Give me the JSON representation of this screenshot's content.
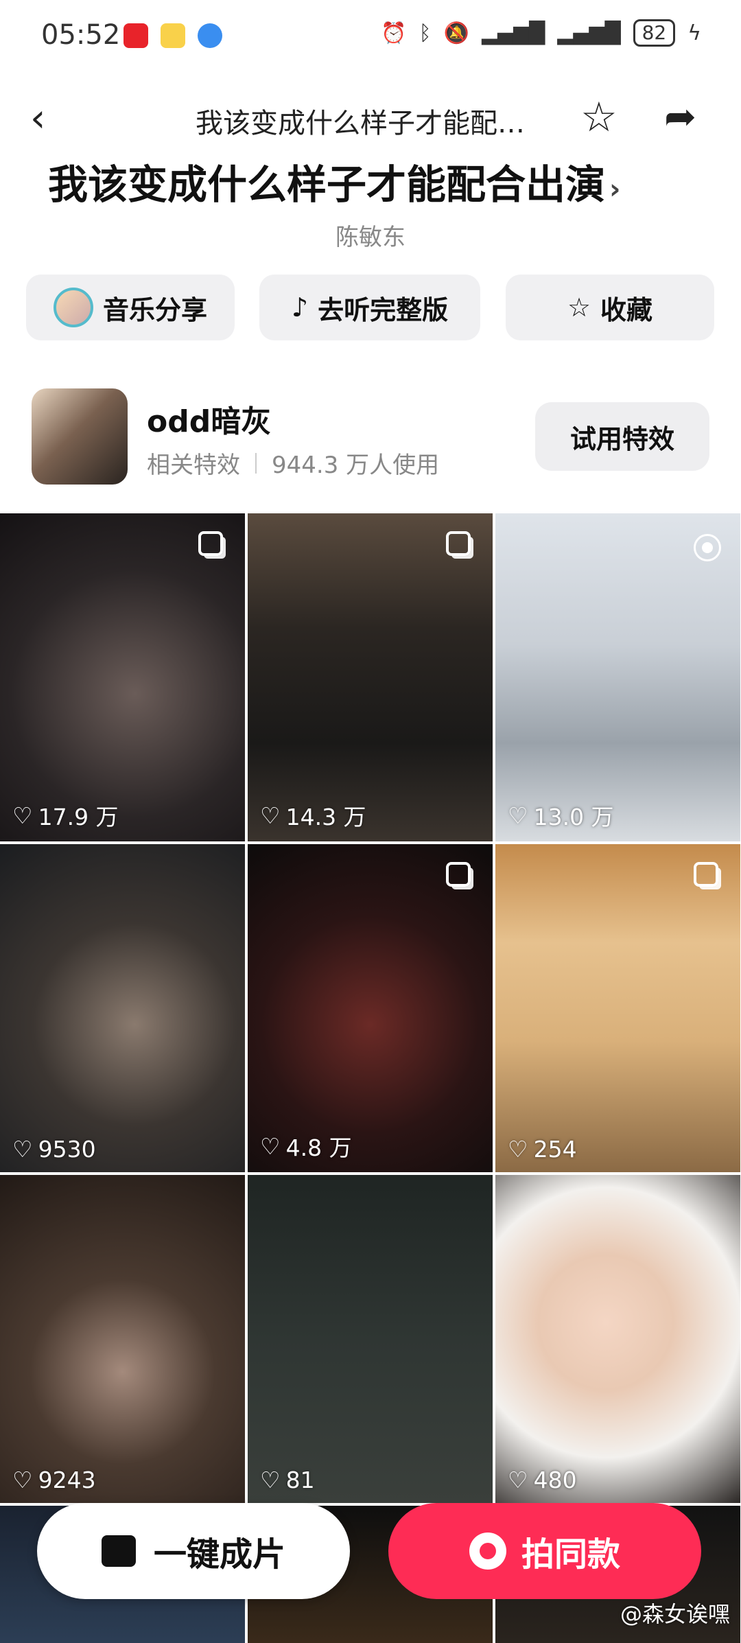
{
  "status_bar": {
    "time": "05:52",
    "battery": "82",
    "icons": [
      "huawei-app-icon",
      "weibo-app-icon",
      "browser-app-icon",
      "alarm-icon",
      "bluetooth-icon",
      "mute-icon",
      "signal-icon",
      "signal-icon",
      "battery-icon",
      "charging-icon"
    ]
  },
  "nav": {
    "back_glyph": "‹",
    "title": "我该变成什么样子才能配…",
    "star_glyph": "☆",
    "share_glyph": "➦"
  },
  "song": {
    "title": "我该变成什么样子才能配合出演",
    "chevron": "›",
    "artist": "陈敏东"
  },
  "actions": [
    {
      "label": "音乐分享"
    },
    {
      "label": "去听完整版",
      "icon": "♪"
    },
    {
      "label": "收藏",
      "icon": "☆"
    }
  ],
  "effect": {
    "name": "odd暗灰",
    "type": "相关特效",
    "usage": "944.3 万人使用",
    "try_label": "试用特效"
  },
  "grid": [
    {
      "likes": "17.9 万",
      "badge": "multi"
    },
    {
      "likes": "14.3 万",
      "badge": "multi"
    },
    {
      "likes": "13.0 万",
      "badge": "live"
    },
    {
      "likes": "9530",
      "badge": "none"
    },
    {
      "likes": "4.8 万",
      "badge": "multi"
    },
    {
      "likes": "254",
      "badge": "multi"
    },
    {
      "likes": "9243",
      "badge": "none"
    },
    {
      "likes": "81",
      "badge": "none"
    },
    {
      "likes": "480",
      "badge": "none"
    }
  ],
  "bottom": {
    "one_key_label": "一键成片",
    "same_label": "拍同款",
    "watermark": "@森女诶嘿"
  },
  "colors": {
    "accent": "#fe2c55",
    "pill_bg": "#f0f0f2",
    "muted_text": "#888888"
  },
  "heart_glyph": "♡"
}
